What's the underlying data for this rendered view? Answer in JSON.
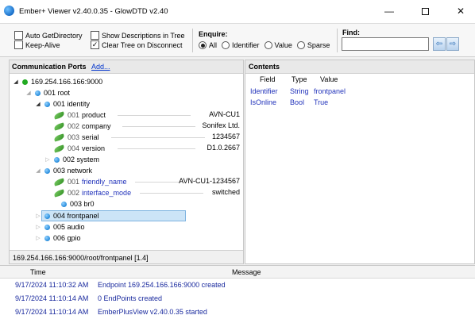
{
  "window": {
    "title": "Ember+ Viewer v2.40.0.35 - GlowDTD v2.40",
    "minimize": "—",
    "close": "✕"
  },
  "toolbar": {
    "auto_get_directory": "Auto GetDirectory",
    "keep_alive": "Keep-Alive",
    "show_descriptions": "Show Descriptions in Tree",
    "clear_tree": "Clear Tree on Disconnect",
    "enquire_title": "Enquire:",
    "enquire_options": [
      "All",
      "Identifier",
      "Value",
      "Sparse"
    ],
    "enquire_selected": "All",
    "find_title": "Find:",
    "find_value": "",
    "clear_tree_checked": true
  },
  "left_panel": {
    "header": "Communication Ports",
    "add_link": "Add...",
    "tree": {
      "root_host": "169.254.166.166:9000",
      "root_node": "001 root",
      "identity": "001 identity",
      "product_num": "001",
      "product": "product",
      "product_val": "AVN-CU1",
      "company_num": "002",
      "company": "company",
      "company_val": "Sonifex Ltd.",
      "serial_num": "003",
      "serial": "serial",
      "serial_val": "1234567",
      "version_num": "004",
      "version": "version",
      "version_val": "D1.0.2667",
      "system": "002 system",
      "network": "003 network",
      "friendly_num": "001",
      "friendly_name": "friendly_name",
      "friendly_val": "AVN-CU1-1234567",
      "iface_num": "002",
      "interface_mode": "interface_mode",
      "iface_val": "switched",
      "br0": "003 br0",
      "frontpanel": "004 frontpanel",
      "audio": "005 audio",
      "gpio": "006 gpio"
    },
    "status": "169.254.166.166:9000/root/frontpanel [1.4]"
  },
  "right_panel": {
    "header": "Contents",
    "columns": [
      "Field",
      "Type",
      "Value"
    ],
    "rows": [
      {
        "field": "Identifier",
        "type": "String",
        "value": "frontpanel"
      },
      {
        "field": "IsOnline",
        "type": "Bool",
        "value": "True"
      }
    ]
  },
  "log": {
    "columns": [
      "Time",
      "Message"
    ],
    "rows": [
      {
        "time": "9/17/2024 11:10:32 AM",
        "message": "Endpoint 169.254.166.166:9000 created"
      },
      {
        "time": "9/17/2024 11:10:14 AM",
        "message": "0 EndPoints created"
      },
      {
        "time": "9/17/2024 11:10:14 AM",
        "message": "EmberPlusView v2.40.0.35 started"
      }
    ]
  }
}
